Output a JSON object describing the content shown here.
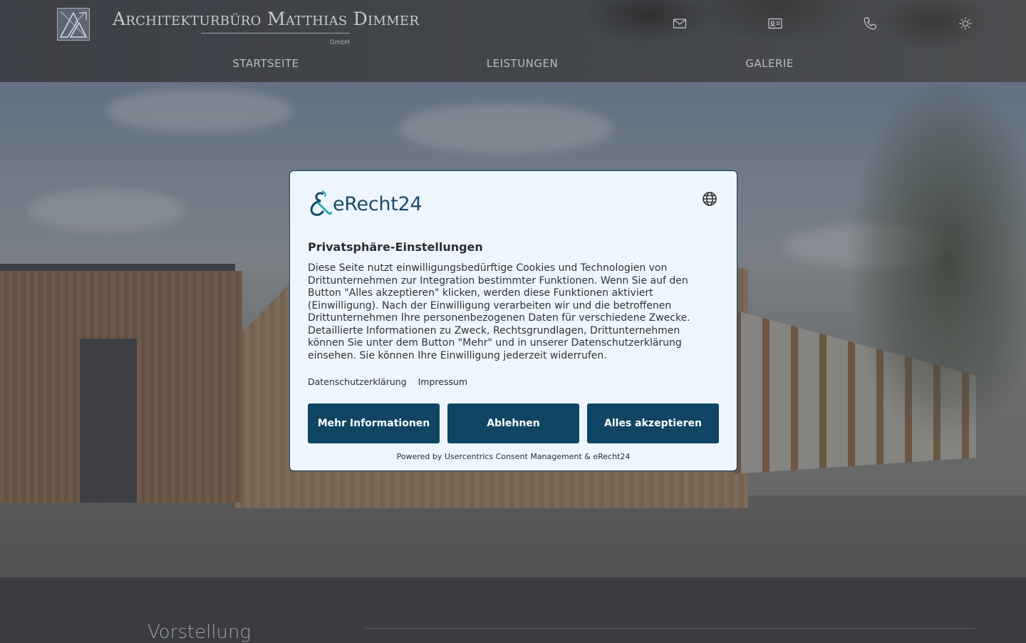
{
  "header": {
    "brand_name": "Architekturbüro Matthias Dimmer",
    "brand_suffix": "GmbH",
    "icons": [
      "mail-icon",
      "contact-card-icon",
      "phone-icon",
      "sun-icon"
    ],
    "nav": [
      "STARTSEITE",
      "LEISTUNGEN",
      "GALERIE"
    ]
  },
  "section": {
    "title": "Vorstellung"
  },
  "consent": {
    "logo_text": "eRecht24",
    "title": "Privatsphäre-Einstellungen",
    "body": "Diese Seite nutzt einwilligungsbedürftige Cookies und Technologien von Drittunternehmen zur Integration bestimmter Funktionen. Wenn Sie auf den Button \"Alles akzeptieren\" klicken, werden diese Funktionen aktiviert (Einwilligung). Nach der Einwilligung verarbeiten wir und die betroffenen Drittunternehmen Ihre personenbezogenen Daten für verschiedene Zwecke. Detaillierte Informationen zu Zweck, Rechtsgrundlagen, Drittunternehmen können Sie unter dem Button \"Mehr\" und in unserer Datenschutzerklärung einsehen. Sie können Ihre Einwilligung jederzeit widerrufen.",
    "link_privacy": "Datenschutzerklärung",
    "link_imprint": "Impressum",
    "btn_more": "Mehr Informationen",
    "btn_deny": "Ablehnen",
    "btn_accept": "Alles akzeptieren",
    "powered_by": "Powered by Usercentrics Consent Management & eRecht24",
    "colors": {
      "button_bg": "#0f4563",
      "dialog_bg": "#eef6fd"
    }
  }
}
